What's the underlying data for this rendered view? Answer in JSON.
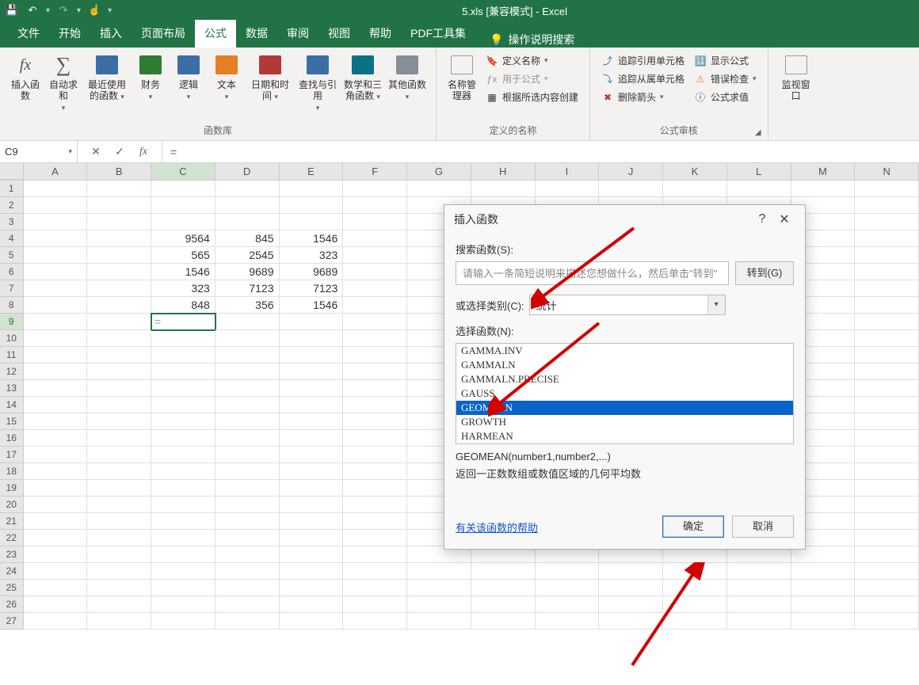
{
  "titlebar": {
    "doc_title": "5.xls [兼容模式] - Excel"
  },
  "tabs": {
    "items": [
      "文件",
      "开始",
      "插入",
      "页面布局",
      "公式",
      "数据",
      "审阅",
      "视图",
      "帮助",
      "PDF工具集"
    ],
    "active_index": 4,
    "search_placeholder": "操作说明搜索"
  },
  "ribbon": {
    "insert_function": "插入函数",
    "autosum": "自动求和",
    "recently_used": "最近使用的函数",
    "financial": "财务",
    "logical": "逻辑",
    "text": "文本",
    "date_time": "日期和时间",
    "lookup_ref": "查找与引用",
    "math_trig": "数学和三角函数",
    "more_functions": "其他函数",
    "function_library_group": "函数库",
    "name_manager": "名称管理器",
    "define_name": "定义名称",
    "use_in_formula": "用于公式",
    "create_from_selection": "根据所选内容创建",
    "defined_names_group": "定义的名称",
    "trace_precedents": "追踪引用单元格",
    "trace_dependents": "追踪从属单元格",
    "remove_arrows": "删除箭头",
    "show_formulas": "显示公式",
    "error_checking": "错误检查",
    "evaluate_formula": "公式求值",
    "formula_auditing_group": "公式审核",
    "watch_window": "监视窗口"
  },
  "formula_bar": {
    "name_box": "C9",
    "formula": "="
  },
  "columns": [
    "A",
    "B",
    "C",
    "D",
    "E",
    "F",
    "G",
    "H",
    "I",
    "J",
    "K",
    "L",
    "M",
    "N"
  ],
  "row_count": 27,
  "active_cell": {
    "row": 9,
    "col": 2,
    "display": "="
  },
  "cells": {
    "r4": {
      "C": "9564",
      "D": "845",
      "E": "1546"
    },
    "r5": {
      "C": "565",
      "D": "2545",
      "E": "323"
    },
    "r6": {
      "C": "1546",
      "D": "9689",
      "E": "9689"
    },
    "r7": {
      "C": "323",
      "D": "7123",
      "E": "7123"
    },
    "r8": {
      "C": "848",
      "D": "356",
      "E": "1546"
    }
  },
  "dialog": {
    "title": "插入函数",
    "search_label": "搜索函数(S):",
    "search_placeholder": "请输入一条简短说明来描述您想做什么，然后单击\"转到\"",
    "goto_btn": "转到(G)",
    "category_label": "或选择类别(C):",
    "category_value": "统计",
    "select_function_label": "选择函数(N):",
    "functions": [
      "GAMMA.INV",
      "GAMMALN",
      "GAMMALN.PRECISE",
      "GAUSS",
      "GEOMEAN",
      "GROWTH",
      "HARMEAN"
    ],
    "selected_function_index": 4,
    "syntax": "GEOMEAN(number1,number2,...)",
    "description": "返回一正数数组或数值区域的几何平均数",
    "help_link": "有关该函数的帮助",
    "ok": "确定",
    "cancel": "取消"
  }
}
